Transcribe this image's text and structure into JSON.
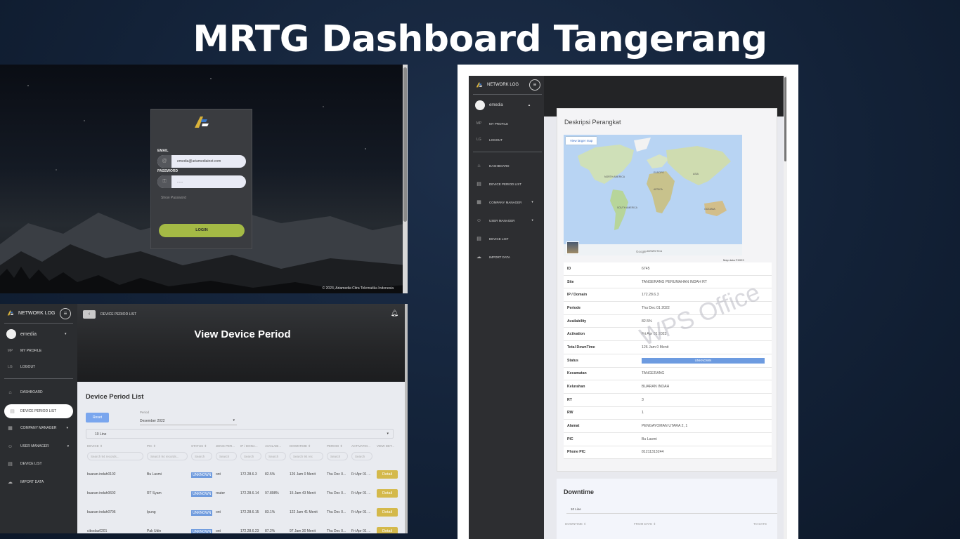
{
  "slide_title": "MRTG Dashboard Tangerang",
  "login": {
    "email_label": "EMAIL",
    "email_value": "emedia@ariamediainet.com",
    "password_label": "PASSWORD",
    "password_value": "......",
    "show_password": "Show Password",
    "login_button": "LOGIN",
    "copyright": "© 2023, Ariamedia Citra Telematika Indonesia"
  },
  "sidebar": {
    "brand": "NETWORK LOG",
    "user": "emedia",
    "profile": {
      "abbr": "MP",
      "label": "MY PROFILE"
    },
    "logout": {
      "abbr": "LG",
      "label": "LOGOUT"
    },
    "items": [
      {
        "label": "DASHBOARD",
        "icon": "building-icon"
      },
      {
        "label": "DEVICE PERIOD LIST",
        "icon": "document-icon"
      },
      {
        "label": "COMPANY MANAGER",
        "icon": "company-icon"
      },
      {
        "label": "USER MANAGER",
        "icon": "user-icon"
      },
      {
        "label": "DEVICE LIST",
        "icon": "list-icon"
      },
      {
        "label": "IMPORT DATA",
        "icon": "cloud-upload-icon"
      }
    ]
  },
  "period": {
    "breadcrumb": "DEVICE PERIOD LIST",
    "page_title": "View Device Period",
    "card_title": "Device Period List",
    "reset_button": "Reset",
    "period_label": "Period",
    "period_value": "Desember 2022",
    "line_select": "10 Line",
    "headers": [
      "DEVICE ⇕",
      "PIC ⇕",
      "STATUS ⇕",
      "JENIS PER...",
      "IP / DONA...",
      "AVAILABI...",
      "DOWNTIME ⇕",
      "PERIOD ⇕",
      "ACTIVATIO...",
      "VIEW DET..."
    ],
    "search_placeholders": [
      "Search 94 records...",
      "Search 94 records...",
      "Search",
      "Search",
      "Search",
      "Search",
      "Search 94 rec",
      "Search",
      "Search"
    ],
    "rows": [
      {
        "device": "buaran-indah0102",
        "pic": "Bu Lasmi",
        "status": "UNKNOWN",
        "jenis": "ont",
        "ip": "172.28.6.3",
        "avail": "82.5%",
        "downtime": "126 Jam 0 Menit",
        "period": "Thu Dec 0...",
        "activation": "Fri Apr 01 ...",
        "detail": "Detail"
      },
      {
        "device": "buaran-indah0602",
        "pic": "RT Syam",
        "status": "UNKNOWN",
        "jenis": "router",
        "ip": "172.28.6.14",
        "avail": "97.898%",
        "downtime": "15 Jam 43 Menit",
        "period": "Thu Dec 0...",
        "activation": "Fri Apr 01 ...",
        "detail": "Detail"
      },
      {
        "device": "buaran-indah0706",
        "pic": "Ipung",
        "status": "UNKNOWN",
        "jenis": "ont",
        "ip": "172.28.6.15",
        "avail": "83.1%",
        "downtime": "122 Jam 41 Menit",
        "period": "Thu Dec 0...",
        "activation": "Fri Apr 01 ...",
        "detail": "Detail"
      },
      {
        "device": "cibodas0201",
        "pic": "Pak Udin",
        "status": "UNKNOWN",
        "jenis": "ont",
        "ip": "172.28.6.23",
        "avail": "87.2%",
        "downtime": "97 Jam 30 Menit",
        "period": "Thu Dec 0...",
        "activation": "Fri Apr 01 ...",
        "detail": "Detail"
      }
    ]
  },
  "desc": {
    "card_title": "Deskripsi Perangkat",
    "view_larger_map": "View larger map",
    "map_labels": {
      "north_america": "NORTH AMERICA",
      "south_america": "SOUTH AMERICA",
      "europe": "EUROPE",
      "africa": "AFRICA",
      "asia": "ASIA",
      "oceania": "OCEANIA",
      "antarctica": "ANTARCTICA"
    },
    "map_credit": "Map data ©2023",
    "google": "Google",
    "fields": [
      {
        "key": "ID",
        "value": "6745"
      },
      {
        "key": "Site",
        "value": "TANGERANG PERUMAHAN INDAH RT"
      },
      {
        "key": "IP / Domain",
        "value": "172.28.6.3"
      },
      {
        "key": "Periode",
        "value": "Thu Dec 01 2022"
      },
      {
        "key": "Availability",
        "value": "82.5%"
      },
      {
        "key": "Activation",
        "value": "Fri Apr 01 2022"
      },
      {
        "key": "Total DownTime",
        "value": "126 Jam 0 Menit"
      },
      {
        "key": "Status",
        "value": "UNKNOWN"
      },
      {
        "key": "Kecamatan",
        "value": "TANGERANG"
      },
      {
        "key": "Kelurahan",
        "value": "BUARAN INDAH"
      },
      {
        "key": "RT",
        "value": "3"
      },
      {
        "key": "RW",
        "value": "1"
      },
      {
        "key": "Alamat",
        "value": "PENGAYOMAN UTARA 2, 1"
      },
      {
        "key": "PIC",
        "value": "Bu Lasmi"
      },
      {
        "key": "Phone PIC",
        "value": "81211313244"
      }
    ],
    "downtime_title": "Downtime",
    "downtime_select": "10 Line",
    "downtime_headers": [
      "DOWNTIME ⇕",
      "FROM DATE ⇕",
      "TO DATE"
    ],
    "watermark": "WPS Office"
  },
  "colors": {
    "accent_login": "#a4ba45",
    "status_unknown": "#6f9bde",
    "detail": "#d4b94b"
  }
}
